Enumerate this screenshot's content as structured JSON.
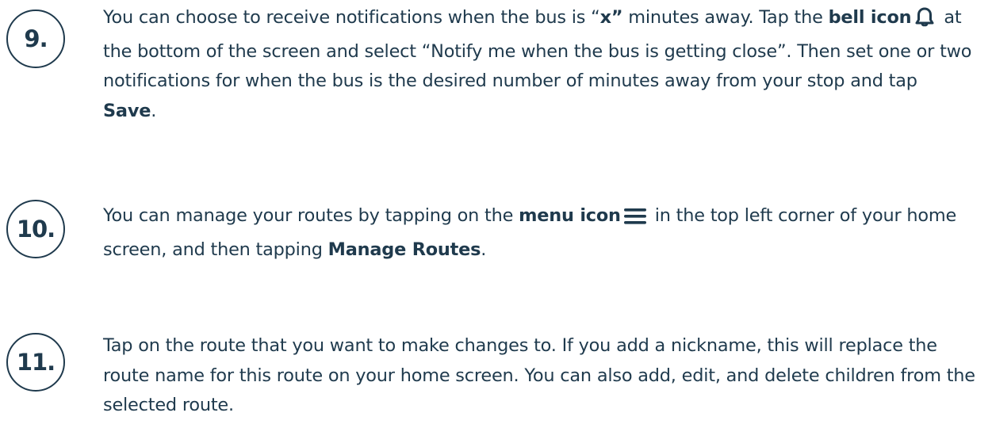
{
  "steps": [
    {
      "number": "9.",
      "segments": [
        "You can choose to receive notifications when the bus is “",
        "x”",
        " minutes away. Tap the ",
        "bell icon",
        " at the bottom of the screen and select “Notify me when the bus is getting close”. Then set one or two notifications for when the bus is the desired number of minutes away from your stop and tap ",
        "Save",
        "."
      ],
      "icon": "bell-icon"
    },
    {
      "number": "10.",
      "segments": [
        "You can manage your routes by tapping on the ",
        "menu icon",
        " in the top left corner of your home screen, and then tapping ",
        "Manage Routes",
        "."
      ],
      "icon": "menu-icon"
    },
    {
      "number": "11.",
      "segments": [
        "Tap on the route that you want to make changes to. If you add a nickname, this will replace the route name for this route on your home screen. You can also add, edit, and delete children from the selected route."
      ]
    }
  ],
  "colors": {
    "text": "#1f3a4d",
    "background": "#ffffff"
  }
}
